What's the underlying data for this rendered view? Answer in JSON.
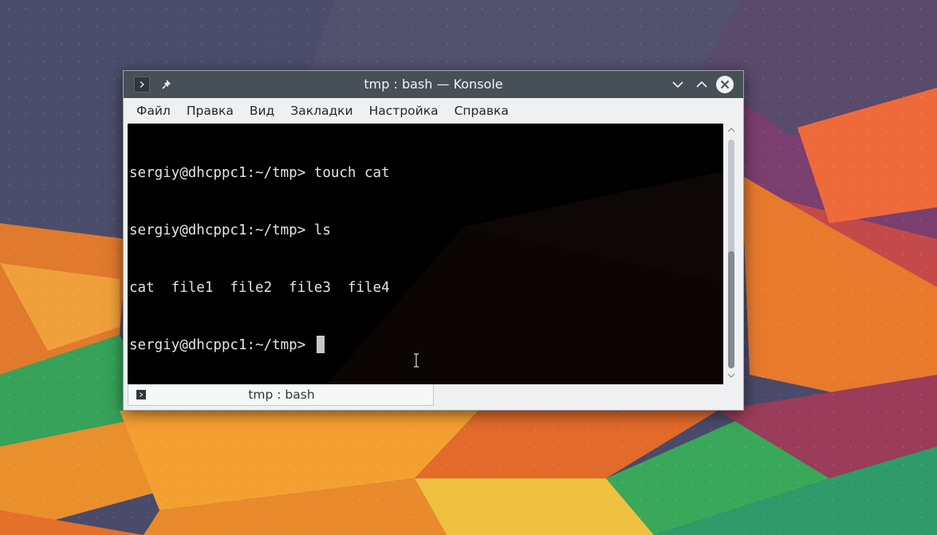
{
  "window": {
    "title": "tmp : bash — Konsole",
    "titlebar_color": "#475057",
    "icons": {
      "app_menu": "terminal-prompt-icon",
      "pin": "pin-icon",
      "minimize": "chevron-down-icon",
      "maximize": "chevron-up-icon",
      "close": "close-icon"
    }
  },
  "menubar": {
    "items": [
      "Файл",
      "Правка",
      "Вид",
      "Закладки",
      "Настройка",
      "Справка"
    ]
  },
  "terminal": {
    "background": "#000000",
    "foreground": "#e4e4e4",
    "lines": [
      "sergiy@dhcppc1:~/tmp> touch cat",
      "sergiy@dhcppc1:~/tmp> ls",
      "cat  file1  file2  file3  file4",
      "sergiy@dhcppc1:~/tmp> "
    ]
  },
  "tabs": [
    {
      "label": "tmp : bash",
      "icon": "terminal-prompt-icon"
    }
  ]
}
